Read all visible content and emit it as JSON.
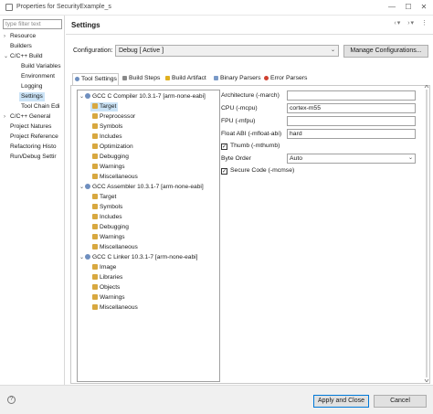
{
  "window": {
    "title": "Properties for SecurityExample_s",
    "minimize": "—",
    "maximize": "☐",
    "close": "✕"
  },
  "nav": {
    "filter_placeholder": "type filter text",
    "items": [
      {
        "label": "Resource",
        "chevron": "›"
      },
      {
        "label": "Builders",
        "chevron": ""
      },
      {
        "label": "C/C++ Build",
        "chevron": "⌄"
      },
      {
        "label": "Build Variables",
        "chevron": ""
      },
      {
        "label": "Environment",
        "chevron": ""
      },
      {
        "label": "Logging",
        "chevron": ""
      },
      {
        "label": "Settings",
        "chevron": ""
      },
      {
        "label": "Tool Chain Edi",
        "chevron": ""
      },
      {
        "label": "C/C++ General",
        "chevron": "›"
      },
      {
        "label": "Project Natures",
        "chevron": ""
      },
      {
        "label": "Project Reference",
        "chevron": ""
      },
      {
        "label": "Refactoring Histo",
        "chevron": ""
      },
      {
        "label": "Run/Debug Settir",
        "chevron": ""
      }
    ]
  },
  "page": {
    "title": "Settings",
    "header_icons": {
      "back": "‹",
      "back_menu": "▾",
      "forward": "›",
      "forward_menu": "▾",
      "more": "⋮"
    }
  },
  "config": {
    "label": "Configuration:",
    "value": "Debug  [ Active ]",
    "manage_button": "Manage Configurations...",
    "arrow": "⌄"
  },
  "tabs": [
    "Tool Settings",
    "Build Steps",
    "Build Artifact",
    "Binary Parsers",
    "Error Parsers"
  ],
  "tree": {
    "groups": [
      {
        "label": "GCC C Compiler 10.3.1-7 [arm-none-eabi]",
        "items": [
          "Target",
          "Preprocessor",
          "Symbols",
          "Includes",
          "Optimization",
          "Debugging",
          "Warnings",
          "Miscellaneous"
        ]
      },
      {
        "label": "GCC Assembler 10.3.1-7 [arm-none-eabi]",
        "items": [
          "Target",
          "Symbols",
          "Includes",
          "Debugging",
          "Warnings",
          "Miscellaneous"
        ]
      },
      {
        "label": "GCC C Linker 10.3.1-7 [arm-none-eabi]",
        "items": [
          "Image",
          "Libraries",
          "Objects",
          "Warnings",
          "Miscellaneous"
        ]
      }
    ],
    "expanded_chevron": "⌄",
    "selected": "Target"
  },
  "form": {
    "architecture_label": "Architecture (-march)",
    "architecture_value": "",
    "cpu_label": "CPU (-mcpu)",
    "cpu_value": "cortex-m55",
    "fpu_label": "FPU (-mfpu)",
    "fpu_value": "",
    "float_abi_label": "Float ABI (-mfloat-abi)",
    "float_abi_value": "hard",
    "thumb_label": "Thumb (-mthumb)",
    "thumb_checked": "✓",
    "byte_order_label": "Byte Order",
    "byte_order_value": "Auto",
    "secure_code_label": "Secure Code (-mcmse)",
    "secure_code_checked": "✓",
    "select_arrow": "⌄"
  },
  "footer": {
    "help": "?",
    "apply_close": "Apply and Close",
    "cancel": "Cancel"
  },
  "colors": {
    "selection": "#cce4f7",
    "button": "#e1e1e1",
    "primary_border": "#0078d7"
  }
}
